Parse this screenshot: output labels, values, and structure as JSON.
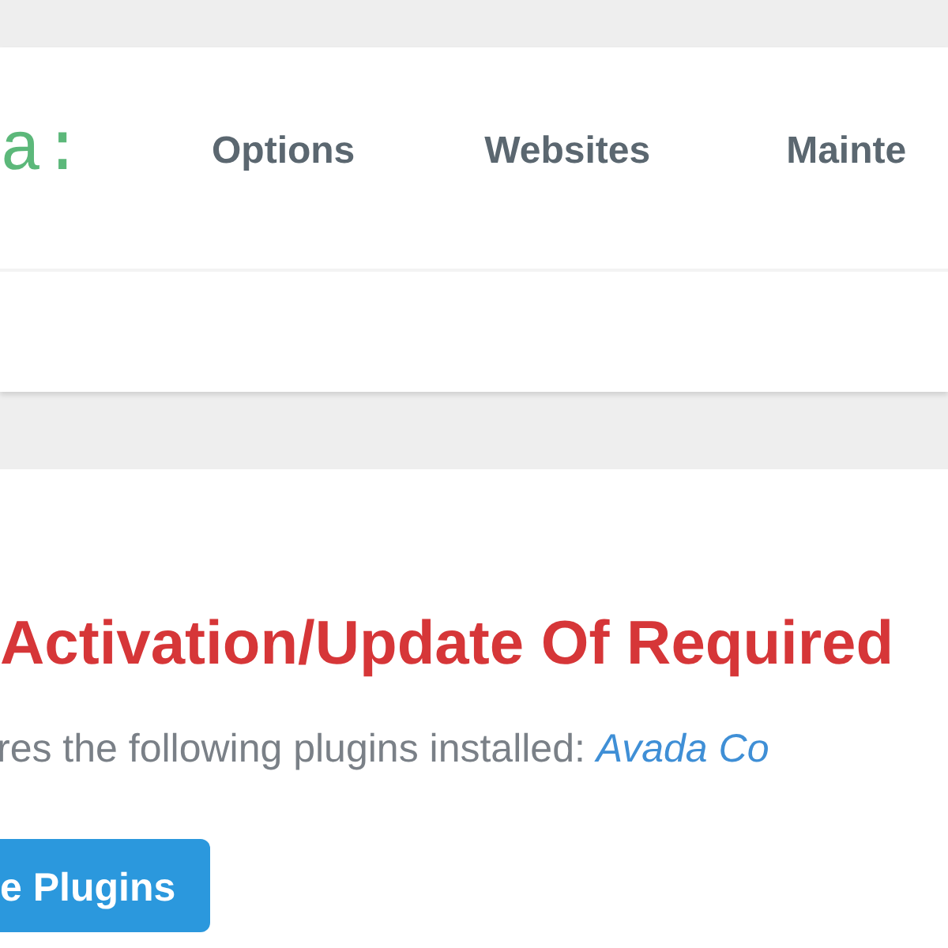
{
  "header": {
    "logo": "a:",
    "nav": [
      {
        "label": "Options"
      },
      {
        "label": "Websites"
      },
      {
        "label": "Mainte"
      }
    ]
  },
  "notice": {
    "title": "Activation/Update Of Required",
    "text": "res the following plugins installed: ",
    "link": "Avada Co",
    "button": "e Plugins"
  }
}
